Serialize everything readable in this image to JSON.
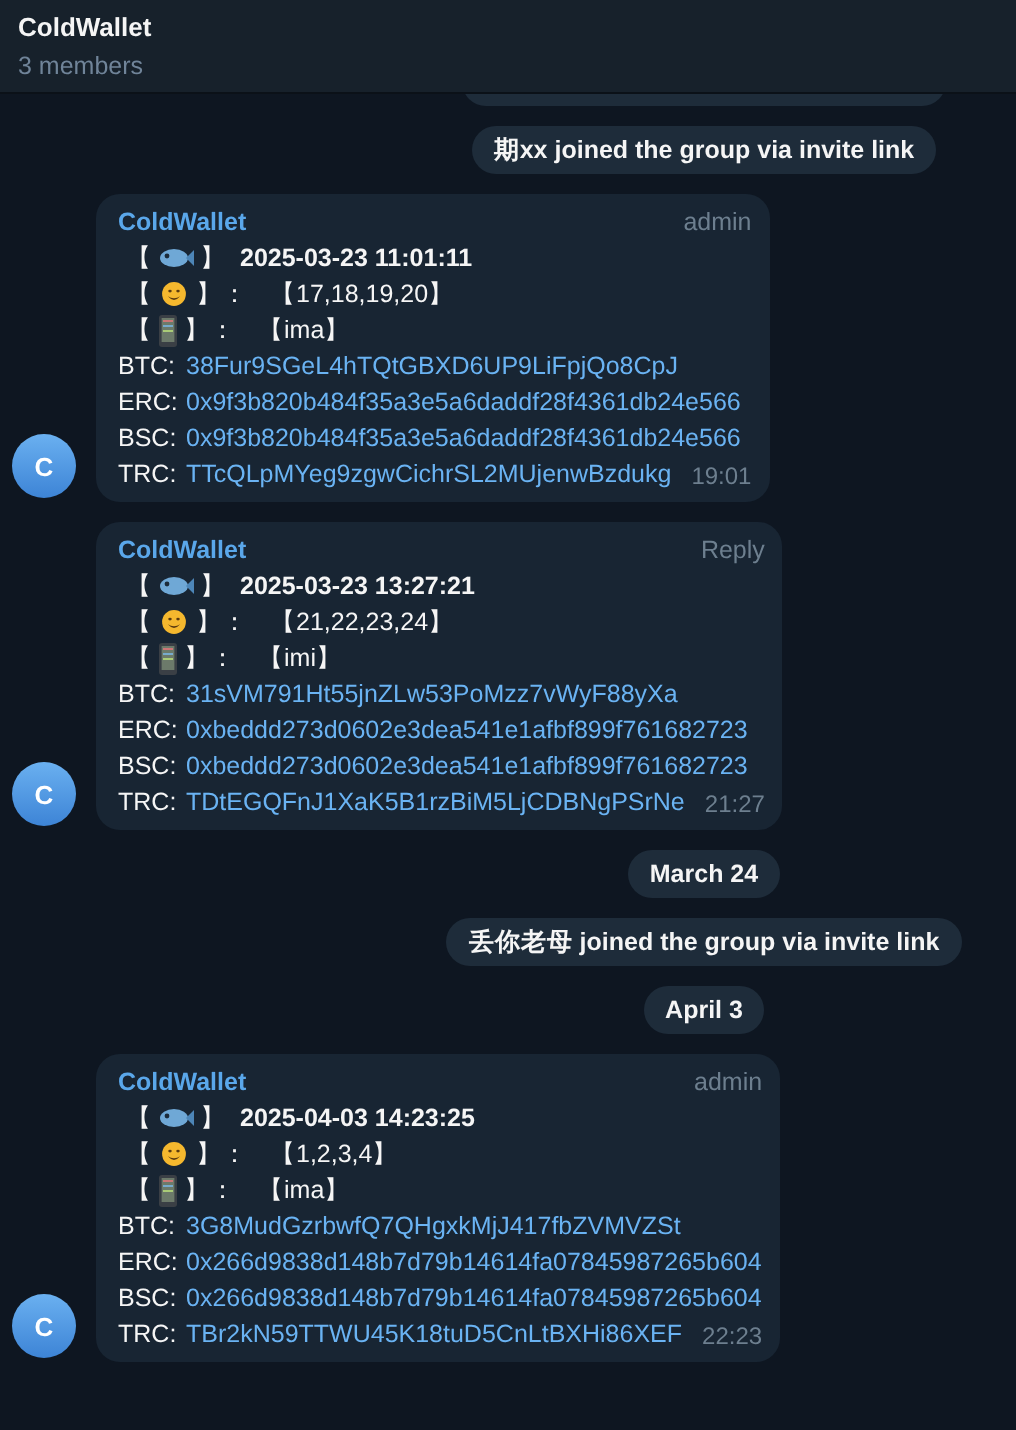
{
  "header": {
    "title": "ColdWallet",
    "subtitle": "3 members"
  },
  "feed": [
    {
      "kind": "clipped"
    },
    {
      "kind": "service",
      "text": "期xx joined the group via invite link"
    },
    {
      "kind": "message",
      "sender": "ColdWallet",
      "tag": "admin",
      "avatar": "C",
      "time": "19:01",
      "time_line": {
        "open": "【",
        "close": "】",
        "value": "2025-03-23 11:01:11"
      },
      "count_line": {
        "open": "【",
        "close": "】：",
        "value": "【17,18,19,20】"
      },
      "device_line": {
        "open": "【",
        "close": "】：",
        "value": "【ima】"
      },
      "addresses": [
        {
          "label": "BTC:",
          "value": "38Fur9SGeL4hTQtGBXD6UP9LiFpjQo8CpJ"
        },
        {
          "label": "ERC:",
          "value": "0x9f3b820b484f35a3e5a6daddf28f4361db24e566"
        },
        {
          "label": "BSC:",
          "value": "0x9f3b820b484f35a3e5a6daddf28f4361db24e566"
        },
        {
          "label": "TRC:",
          "value": "TTcQLpMYeg9zgwCichrSL2MUjenwBzdukg"
        }
      ]
    },
    {
      "kind": "message",
      "sender": "ColdWallet",
      "tag": "Reply",
      "avatar": "C",
      "time": "21:27",
      "time_line": {
        "open": "【",
        "close": "】",
        "value": "2025-03-23 13:27:21"
      },
      "count_line": {
        "open": "【",
        "close": "】：",
        "value": "【21,22,23,24】"
      },
      "device_line": {
        "open": "【",
        "close": "】：",
        "value": "【imi】"
      },
      "addresses": [
        {
          "label": "BTC:",
          "value": "31sVM791Ht55jnZLw53PoMzz7vWyF88yXa"
        },
        {
          "label": "ERC:",
          "value": "0xbeddd273d0602e3dea541e1afbf899f761682723"
        },
        {
          "label": "BSC:",
          "value": "0xbeddd273d0602e3dea541e1afbf899f761682723"
        },
        {
          "label": "TRC:",
          "value": "TDtEGQFnJ1XaK5B1rzBiM5LjCDBNgPSrNe"
        }
      ]
    },
    {
      "kind": "date",
      "text": "March 24"
    },
    {
      "kind": "service",
      "text": "丢你老母 joined the group via invite link"
    },
    {
      "kind": "date",
      "text": "April 3"
    },
    {
      "kind": "message",
      "sender": "ColdWallet",
      "tag": "admin",
      "avatar": "C",
      "time": "22:23",
      "time_line": {
        "open": "【",
        "close": "】",
        "value": "2025-04-03 14:23:25"
      },
      "count_line": {
        "open": "【",
        "close": "】：",
        "value": "【1,2,3,4】"
      },
      "device_line": {
        "open": "【",
        "close": "】：",
        "value": "【ima】"
      },
      "addresses": [
        {
          "label": "BTC:",
          "value": "3G8MudGzrbwfQ7QHgxkMjJ417fbZVMVZSt"
        },
        {
          "label": "ERC:",
          "value": "0x266d9838d148b7d79b14614fa07845987265b604"
        },
        {
          "label": "BSC:",
          "value": "0x266d9838d148b7d79b14614fa07845987265b604"
        },
        {
          "label": "TRC:",
          "value": "TBr2kN59TTWU45K18tuD5CnLtBXHi86XEF"
        }
      ]
    }
  ]
}
